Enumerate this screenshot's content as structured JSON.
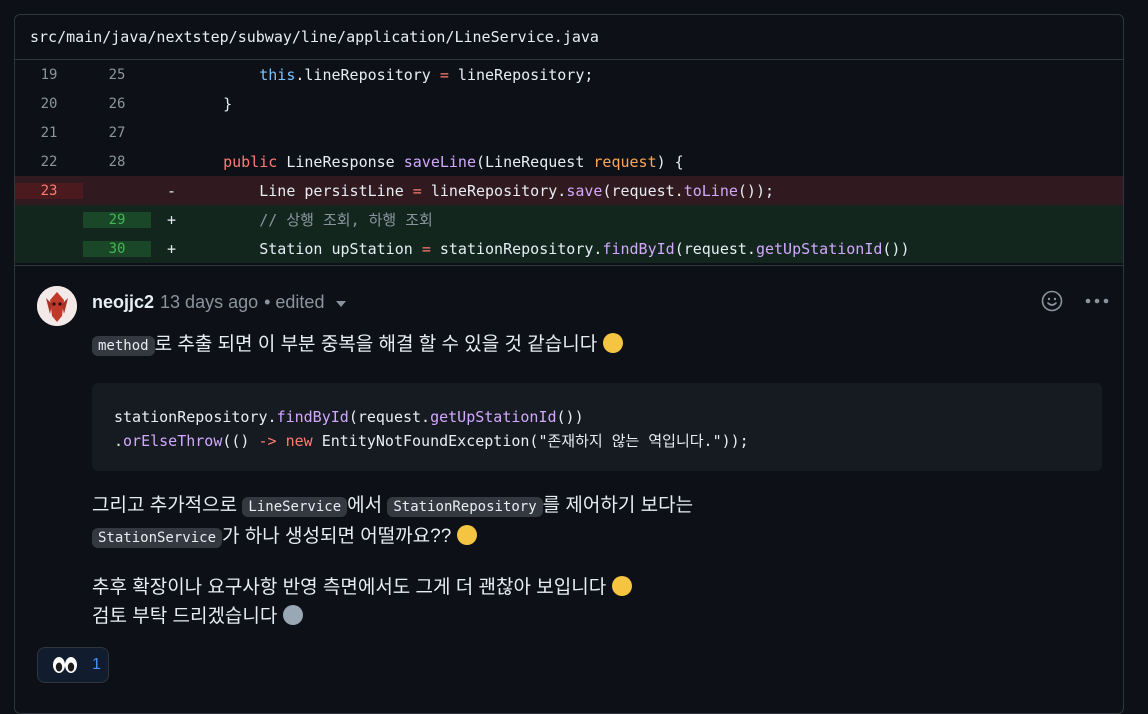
{
  "file": {
    "path": "src/main/java/nextstep/subway/line/application/LineService.java"
  },
  "diff": {
    "rows": [
      {
        "type": "ctx",
        "old": "19",
        "new": "25",
        "sign": "",
        "code": "        this.lineRepository = lineRepository;"
      },
      {
        "type": "ctx",
        "old": "20",
        "new": "26",
        "sign": "",
        "code": "    }"
      },
      {
        "type": "ctx",
        "old": "21",
        "new": "27",
        "sign": "",
        "code": ""
      },
      {
        "type": "ctx",
        "old": "22",
        "new": "28",
        "sign": "",
        "code": "    public LineResponse saveLine(LineRequest request) {"
      },
      {
        "type": "del",
        "old": "23",
        "new": "",
        "sign": "-",
        "code": "        Line persistLine = lineRepository.save(request.toLine());"
      },
      {
        "type": "add",
        "old": "",
        "new": "29",
        "sign": "+",
        "code": "        // 상행 조회, 하행 조회"
      },
      {
        "type": "add",
        "old": "",
        "new": "30",
        "sign": "+",
        "code": "        Station upStation = stationRepository.findById(request.getUpStationId())"
      }
    ]
  },
  "comment": {
    "author": "neojjc2",
    "time": "13 days ago",
    "edited": "• edited",
    "p1_code": "method",
    "p1_text": "로 추출 되면 이 부분 중복을 해결 할 수 있을 것 같습니다",
    "code_block": "stationRepository.findById(request.getUpStationId())\n.orElseThrow(() -> new EntityNotFoundException(\"존재하지 않는 역입니다.\"));",
    "p2_a": "그리고 추가적으로 ",
    "p2_code1": "LineService",
    "p2_b": "에서 ",
    "p2_code2": "StationRepository",
    "p2_c": "를 제어하기 보다는",
    "p2_code3": "StationService",
    "p2_d": "가 하나 생성되면 어떨까요??",
    "p3_line1": "추후 확장이나 요구사항 반영 측면에서도 그게 더 괜찮아 보입니다",
    "p3_line2": "검토 부탁 드리겠습니다",
    "reaction_count": "1"
  },
  "icons": {
    "smile": "smiley-icon",
    "more": "kebab-horizontal-icon",
    "eyes": "eyes-emoji"
  }
}
